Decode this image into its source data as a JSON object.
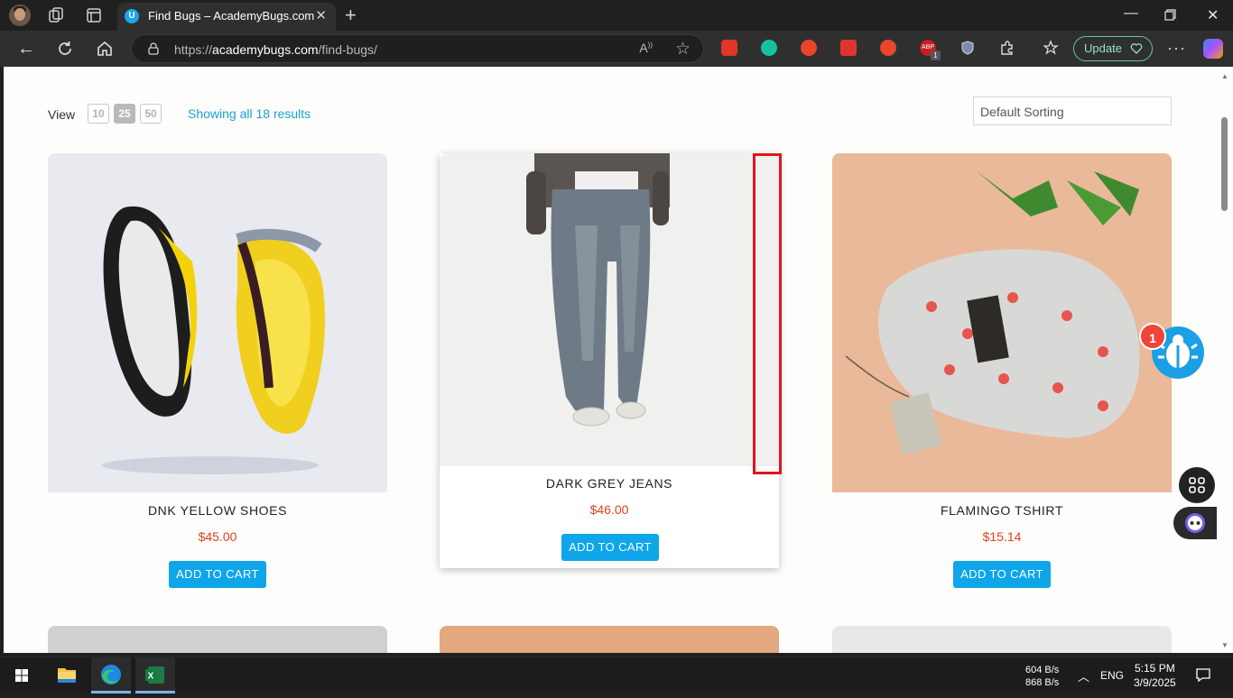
{
  "browser": {
    "tab_title": "Find Bugs – AcademyBugs.com",
    "tab_favicon_letter": "U",
    "url_prefix": "https://",
    "url_domain": "academybugs.com",
    "url_path": "/find-bugs/",
    "update_label": "Update",
    "extension_badges": [
      "ABP",
      "1"
    ]
  },
  "toolbar": {
    "view_label": "View",
    "per_page_options": [
      "10",
      "25",
      "50"
    ],
    "per_page_selected": "25",
    "results_text": "Showing all 18 results",
    "sort_value": "Default Sorting"
  },
  "products": [
    {
      "name": "DNK YELLOW SHOES",
      "price": "$45.00",
      "cart_label": "ADD TO CART"
    },
    {
      "name": "DARK GREY JEANS",
      "price": "$46.00",
      "cart_label": "ADD TO CART"
    },
    {
      "name": "FLAMINGO TSHIRT",
      "price": "$15.14",
      "cart_label": "ADD TO CART"
    }
  ],
  "widgets": {
    "bug_count": "1"
  },
  "taskbar": {
    "net_up": "604 B/s",
    "net_down": "868 B/s",
    "lang": "ENG",
    "time": "5:15 PM",
    "date": "3/9/2025"
  },
  "colors": {
    "accent": "#0ea5e9",
    "price": "#e2401c",
    "link": "#1ba0d6",
    "highlight": "#e0151f"
  }
}
